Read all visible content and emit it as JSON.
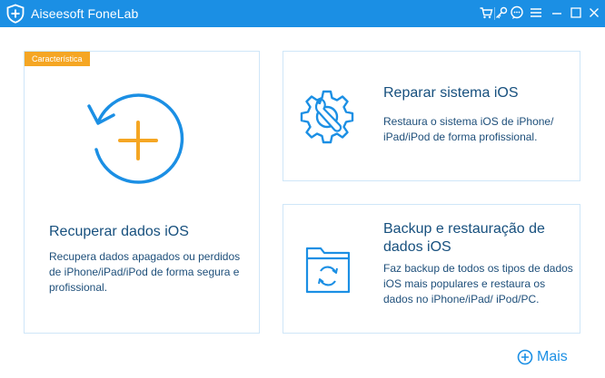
{
  "app": {
    "title": "Aiseesoft FoneLab",
    "logo_icon": "shield-plus-icon"
  },
  "titlebar_icons": [
    "cart-icon",
    "key-icon",
    "chat-icon",
    "menu-icon",
    "minimize-icon",
    "maximize-icon",
    "close-icon"
  ],
  "colors": {
    "titlebar": "#1b8fe4",
    "accent": "#1b8fe4",
    "badge": "#f5a623",
    "plus": "#f5a623"
  },
  "cards": {
    "recover": {
      "badge": "Característica",
      "title": "Recuperar dados iOS",
      "description": "Recupera dados apagados ou perdidos de iPhone/iPad/iPod de forma segura e profissional.",
      "icon": "restore-plus-icon"
    },
    "repair": {
      "title": "Reparar sistema iOS",
      "description": "Restaura o sistema iOS de iPhone/ iPad/iPod de forma profissional.",
      "icon": "wrench-gear-icon"
    },
    "backup": {
      "title": "Backup e restauração de dados iOS",
      "description": "Faz backup de todos os tipos de dados iOS mais populares e restaura os dados no iPhone/iPad/ iPod/PC.",
      "icon": "folder-sync-icon"
    }
  },
  "more": {
    "label": "Mais",
    "icon": "plus-circle-icon"
  }
}
